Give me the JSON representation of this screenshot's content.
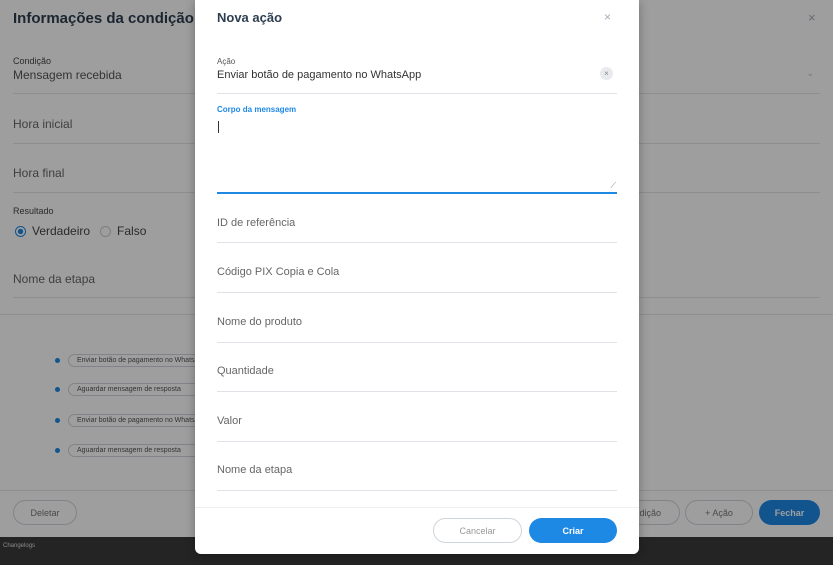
{
  "background": {
    "title": "Informações da condição",
    "close_icon": "×",
    "condition": {
      "label": "Condição",
      "value": "Mensagem recebida"
    },
    "start_time_placeholder": "Hora inicial",
    "end_time_placeholder": "Hora final",
    "result": {
      "label": "Resultado",
      "options": [
        "Verdadeiro",
        "Falso"
      ],
      "selected": "Verdadeiro"
    },
    "step_name_placeholder": "Nome da etapa",
    "steps": [
      "Enviar botão de pagamento no WhatsApp",
      "Aguardar mensagem de resposta",
      "Enviar botão de pagamento no WhatsApp",
      "Aguardar mensagem de resposta"
    ],
    "footer": {
      "delete_label": "Deletar",
      "condition_label": "dição",
      "add_action_label": "+ Ação",
      "close_label": "Fechar"
    },
    "bottom_bar_text": "Changelogs"
  },
  "modal": {
    "title": "Nova ação",
    "close_icon": "×",
    "action": {
      "label": "Ação",
      "value": "Enviar botão de pagamento no WhatsApp",
      "clear_icon": "×"
    },
    "body": {
      "label": "Corpo da mensagem",
      "value": ""
    },
    "fields": [
      "ID de referência",
      "Código PIX Copia e Cola",
      "Nome do produto",
      "Quantidade",
      "Valor",
      "Nome da etapa"
    ],
    "cancel_label": "Cancelar",
    "create_label": "Criar"
  },
  "colors": {
    "accent": "#1e88e5",
    "overlay": "rgba(0,0,0,0.38)",
    "bottom_bar": "#3b3b3b"
  }
}
